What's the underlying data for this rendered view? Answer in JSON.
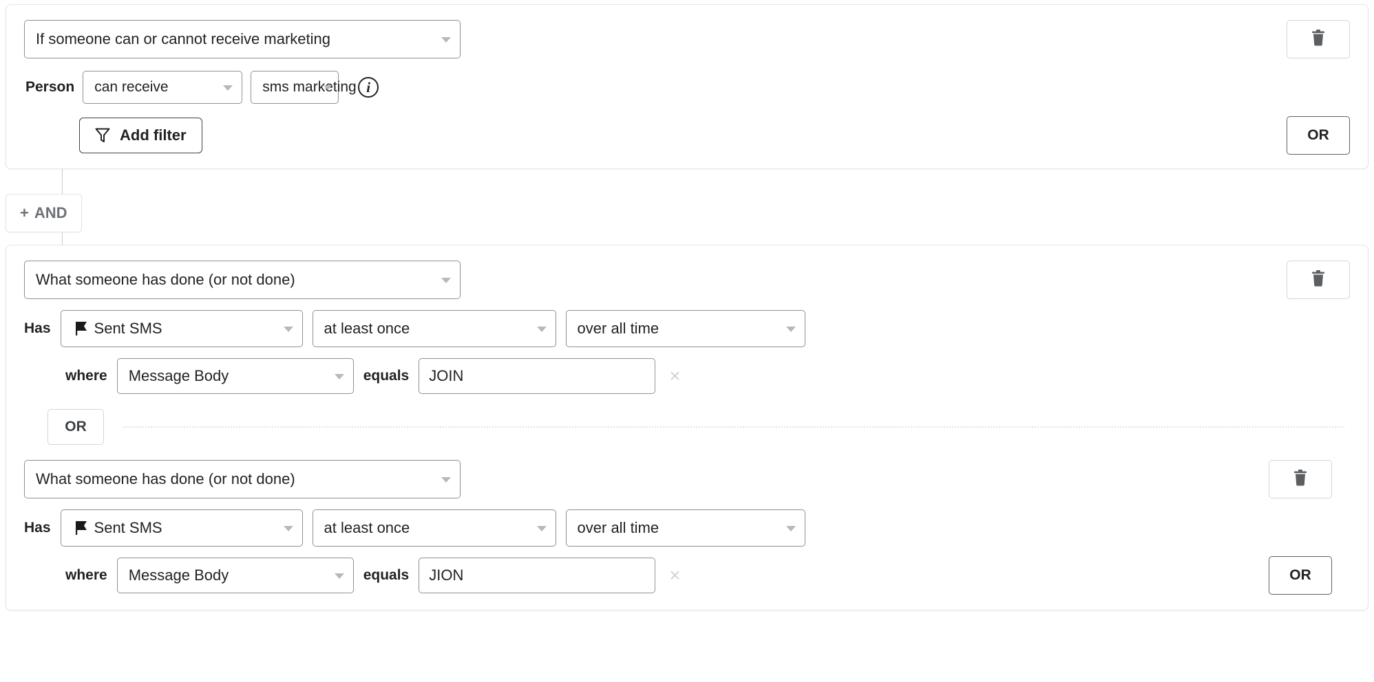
{
  "blocks": [
    {
      "id": "block-marketing",
      "trigger": "If someone can or cannot receive marketing",
      "subject_label": "Person",
      "consent": "can receive",
      "channel": "sms marketing",
      "info_glyph": "i",
      "add_filter_label": "Add filter",
      "or_label": "OR",
      "delete_title": "Delete"
    },
    {
      "id": "block-behavior",
      "conditions": [
        {
          "trigger": "What someone has done (or not done)",
          "has_label": "Has",
          "metric": "Sent SMS",
          "frequency": "at least once",
          "timeframe": "over all time",
          "where_label": "where",
          "dimension": "Message Body",
          "operator_label": "equals",
          "value": "JOIN",
          "remove_glyph": "×"
        },
        {
          "trigger": "What someone has done (or not done)",
          "has_label": "Has",
          "metric": "Sent SMS",
          "frequency": "at least once",
          "timeframe": "over all time",
          "where_label": "where",
          "dimension": "Message Body",
          "operator_label": "equals",
          "value": "JION",
          "remove_glyph": "×"
        }
      ],
      "inner_or_label": "OR",
      "or_label": "OR"
    }
  ],
  "and_connector": {
    "plus_glyph": "+",
    "label": "AND"
  },
  "icons": {
    "trash": "trash-icon",
    "funnel": "funnel-icon",
    "flag": "flag-icon",
    "info": "info-icon",
    "caret": "chevron-down-icon"
  },
  "colors": {
    "border": "#8c9196",
    "card_border": "#e3e5e7",
    "text": "#202223",
    "muted": "#6d7175",
    "caret": "#b5b9bd",
    "divider": "#e0e2e4",
    "remove": "#d0d3d6"
  }
}
